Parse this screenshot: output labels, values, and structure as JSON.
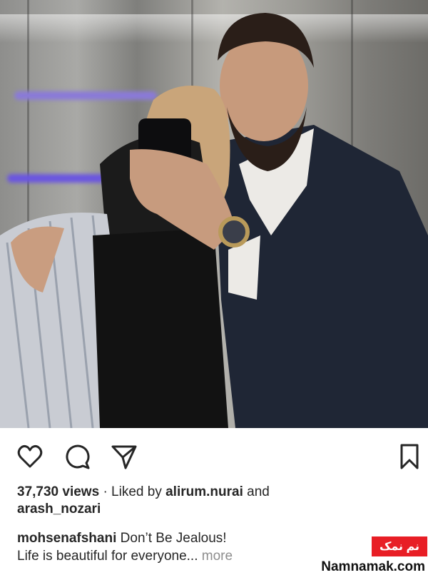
{
  "post": {
    "photo": {
      "alt": "Couple taking a mirror selfie in an elevator"
    },
    "actions": {
      "like_icon": "heart-icon",
      "comment_icon": "comment-icon",
      "share_icon": "send-icon",
      "save_icon": "bookmark-icon"
    },
    "stats": {
      "views": "37,730 views",
      "separator": "·",
      "liked_by_prefix": "Liked by",
      "liker_1": "alirum.nurai",
      "and_word": "and",
      "liker_2": "arash_nozari"
    },
    "caption": {
      "username": "mohsenafshani",
      "text_line1": "Don’t Be Jealous!",
      "text_line2": "Life is beautiful for everyone...",
      "more": "more"
    }
  },
  "watermark": {
    "badge_text": "نم نمک",
    "site": "Namnamak.com",
    "badge_color": "#e81e25"
  },
  "colors": {
    "text": "#262626",
    "muted": "#8e8e8e",
    "background": "#ffffff"
  }
}
